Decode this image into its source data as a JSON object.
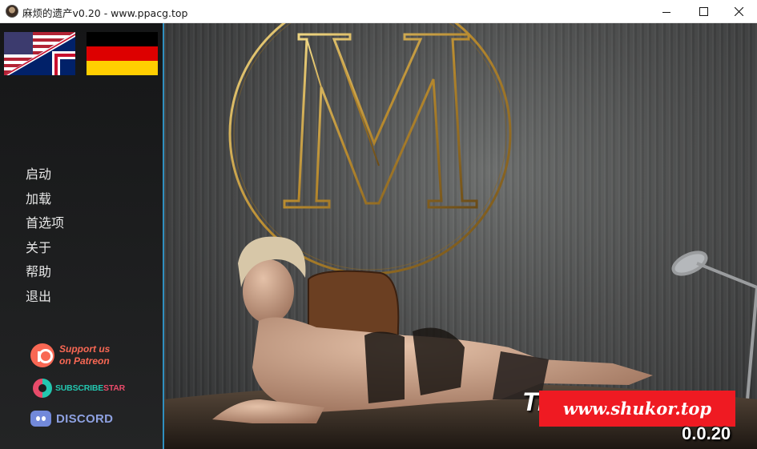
{
  "window": {
    "title": "麻烦的遗产v0.20 - www.ppacg.top",
    "icon": "app-avatar-icon",
    "controls": [
      "minimize-icon",
      "maximize-icon",
      "close-icon"
    ]
  },
  "languages": [
    {
      "name": "English",
      "icon": "flag-us-uk-icon"
    },
    {
      "name": "Deutsch",
      "icon": "flag-germany-icon"
    }
  ],
  "menu": {
    "items": [
      "启动",
      "加载",
      "首选项",
      "关于",
      "帮助",
      "退出"
    ]
  },
  "social": {
    "patreon": {
      "line1": "Support us",
      "line2": "on Patreon",
      "color": "#f96854"
    },
    "subscribestar": {
      "part1": "SUBSCRIBE",
      "part2": "STAR",
      "colors": [
        "#23c7b0",
        "#e84b6a"
      ]
    },
    "discord": {
      "label": "DISCORD",
      "color": "#7289da"
    }
  },
  "game": {
    "title_partial": "Tr",
    "title_end": "/",
    "version": "0.0.20"
  },
  "watermark": {
    "text": "www.shukor.top",
    "color": "#ef1a22"
  },
  "colors": {
    "sidebar_accent": "#2f8fbf",
    "logo_gold": "#c9a24a"
  }
}
